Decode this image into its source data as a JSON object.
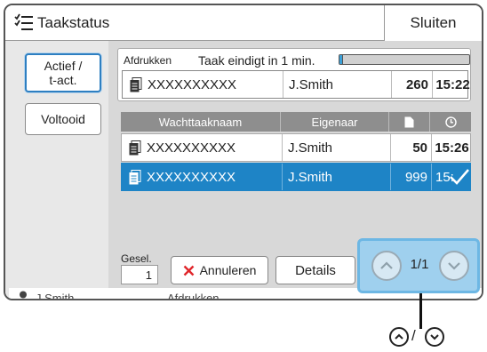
{
  "header": {
    "title": "Taakstatus",
    "close_label": "Sluiten"
  },
  "tabs": {
    "active_line1": "Actief /",
    "active_line2": "t-act.",
    "done": "Voltooid"
  },
  "current_print": {
    "label": "Afdrukken",
    "status": "Taak eindigt in 1 min.",
    "progress_percent": 3,
    "job": {
      "name": "XXXXXXXXXX",
      "owner": "J.Smith",
      "pages": "260",
      "time": "15:22"
    }
  },
  "queue": {
    "headers": {
      "name": "Wachttaaknaam",
      "owner": "Eigenaar"
    },
    "rows": [
      {
        "name": "XXXXXXXXXX",
        "owner": "J.Smith",
        "pages": "50",
        "time": "15:26"
      },
      {
        "name": "XXXXXXXXXX",
        "owner": "J.Smith",
        "pages": "999",
        "time": "15:",
        "selected": true
      }
    ]
  },
  "selection": {
    "label": "Gesel.",
    "count": "1"
  },
  "buttons": {
    "cancel_label": "Annuleren",
    "details_label": "Details"
  },
  "pagination": {
    "indicator": "1/1"
  },
  "footer": {
    "user": "J.Smith",
    "mode": "Afdrukken"
  },
  "callout": {
    "slash": "/"
  },
  "colors": {
    "selected_row": "#1e84c6",
    "highlight": "#9fd0ee",
    "progress": "#3aa0d8"
  },
  "icons": [
    "job-list-icon",
    "document-icon",
    "pages-icon",
    "clock-icon",
    "cancel-x-icon",
    "checkmark-icon",
    "chevron-up-icon",
    "chevron-down-icon",
    "user-icon"
  ]
}
